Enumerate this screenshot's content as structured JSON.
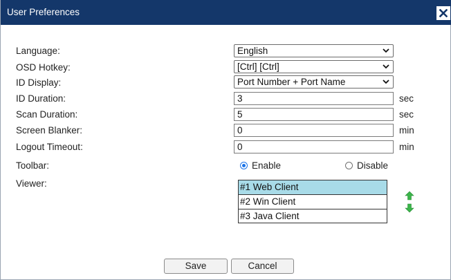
{
  "dialog": {
    "title": "User Preferences",
    "close_icon": "close-icon"
  },
  "fields": {
    "language": {
      "label": "Language:",
      "value": "English"
    },
    "osd_hotkey": {
      "label": "OSD Hotkey:",
      "value": "[Ctrl] [Ctrl]"
    },
    "id_display": {
      "label": "ID Display:",
      "value": "Port Number + Port Name"
    },
    "id_duration": {
      "label": "ID Duration:",
      "value": "3",
      "unit": "sec"
    },
    "scan_duration": {
      "label": "Scan Duration:",
      "value": "5",
      "unit": "sec"
    },
    "screen_blanker": {
      "label": "Screen Blanker:",
      "value": "0",
      "unit": "min"
    },
    "logout_timeout": {
      "label": "Logout Timeout:",
      "value": "0",
      "unit": "min"
    }
  },
  "toolbar": {
    "label": "Toolbar:",
    "enable_label": "Enable",
    "disable_label": "Disable",
    "selected": "Enable"
  },
  "viewer": {
    "label": "Viewer:",
    "items": [
      "#1 Web Client",
      "#2 Win Client",
      "#3 Java Client"
    ],
    "selected_index": 0,
    "move_up_icon": "arrow-up-icon",
    "move_down_icon": "arrow-down-icon"
  },
  "buttons": {
    "save": "Save",
    "cancel": "Cancel"
  },
  "colors": {
    "titlebar": "#14376a",
    "selected_row": "#a8dbe8",
    "radio_accent": "#1a73e8",
    "arrow_green": "#3bb54a"
  }
}
